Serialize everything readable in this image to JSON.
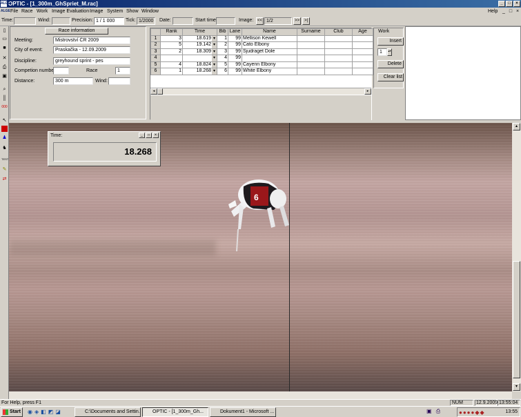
{
  "window": {
    "title": "OPTIC - [1_300m_GhSpriet_M.rac]",
    "icon": "ALGE"
  },
  "menu": [
    "File",
    "Race",
    "Work",
    "Image Evaluation",
    "Image",
    "System",
    "Show",
    "Window"
  ],
  "help_menu": "Help",
  "toolbar": {
    "time_label": "Time:",
    "wind_label": "Wind:",
    "precision_label": "Precision:",
    "precision_value": "1 / 1 000",
    "tick_label": "Tick:",
    "tick_value": "1/2000",
    "date_label": "Date:",
    "start_time_label": "Start time",
    "image_label": "Image:",
    "image_value": "1/2",
    "prev_icon": "<<",
    "next_icon": ">>",
    "last_icon": ">|"
  },
  "race_info": {
    "header": "Race information",
    "meeting_label": "Meeting:",
    "meeting_value": "Mistrovství ČR 2009",
    "city_label": "City of event:",
    "city_value": "Praskačka - 12.09.2009",
    "discipline_label": "Discipline:",
    "discipline_value": "greyhound sprint - pes",
    "competition_label": "Competion number:",
    "competition_value": "",
    "race_label": "Race",
    "race_value": "1",
    "distance_label": "Distance:",
    "distance_value": "300 m",
    "wind_label": "Wind:",
    "wind_value": ""
  },
  "results": {
    "columns": [
      "",
      "Rank",
      "Time",
      "Bib",
      "Lane",
      "Name",
      "Surname",
      "Club",
      "Age"
    ],
    "rows": [
      {
        "n": "1",
        "rank": "3",
        "time": "18.619",
        "bib": "1",
        "lane": "99",
        "name": "Mellison Kewell"
      },
      {
        "n": "2",
        "rank": "5",
        "time": "19.142",
        "bib": "2",
        "lane": "99",
        "name": "Cato Elbony"
      },
      {
        "n": "3",
        "rank": "2",
        "time": "18.309",
        "bib": "3",
        "lane": "99",
        "name": "Sjudraget Dole"
      },
      {
        "n": "4",
        "rank": "",
        "time": "",
        "bib": "4",
        "lane": "99",
        "name": ""
      },
      {
        "n": "5",
        "rank": "4",
        "time": "18.824",
        "bib": "5",
        "lane": "99",
        "name": "Cayenn Elbony"
      },
      {
        "n": "6",
        "rank": "1",
        "time": "18.268",
        "bib": "6",
        "lane": "99",
        "name": "White Elbony"
      }
    ]
  },
  "work": {
    "header": "Work",
    "insert": "Insert",
    "spinner": "1",
    "delete": "Delete",
    "clear": "Clear list"
  },
  "time_popup": {
    "title": "Time:",
    "value": "18.268"
  },
  "status": {
    "help": "For Help, press F1",
    "num": "NUM",
    "date": "12.9.2009",
    "time": "13:55:04"
  },
  "taskbar": {
    "start": "Start",
    "items": [
      "C:\\Documents and Settin...",
      "OPTIC - [1_300m_Gh...",
      "Dokument1 - Microsoft ..."
    ],
    "clock": "13:55"
  },
  "colors": {
    "titlebar": "#0a246a",
    "face": "#d4d0c8"
  }
}
